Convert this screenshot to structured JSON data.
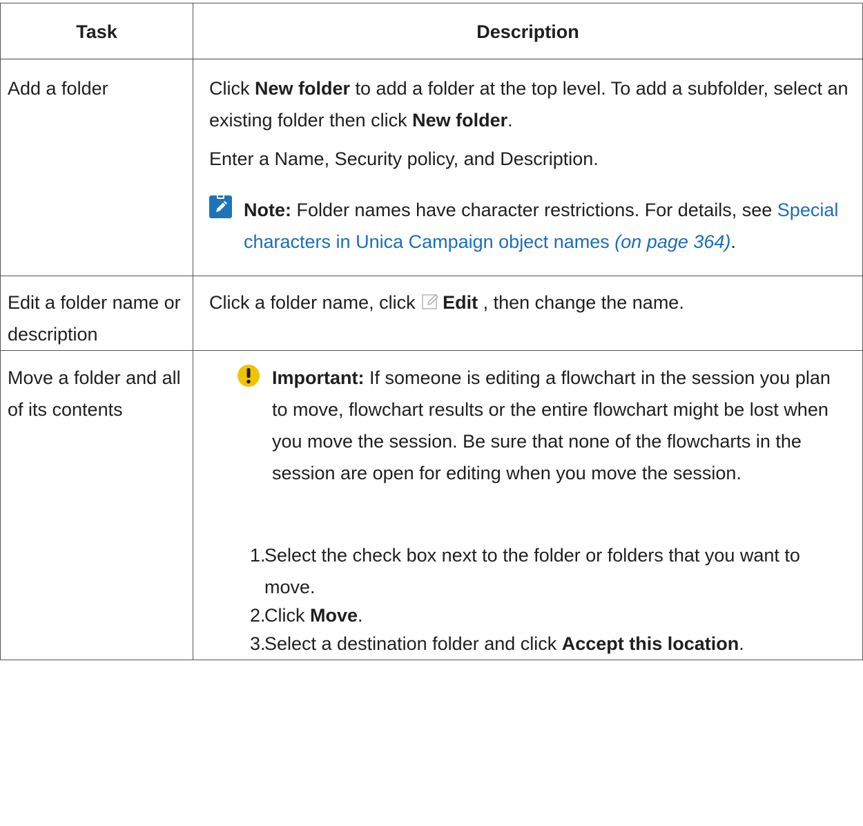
{
  "table": {
    "header": {
      "task": "Task",
      "description": "Description"
    },
    "rows": {
      "add": {
        "task": "Add a folder",
        "p1_a": "Click ",
        "p1_b": "New folder",
        "p1_c": " to add a folder at the top level. To add a subfolder, select an existing folder then click ",
        "p1_d": "New folder",
        "p1_e": ".",
        "p2": "Enter a Name, Security policy, and Description.",
        "note_label": "Note:",
        "note_text": " Folder names have character restrictions. For details, see ",
        "note_link": "Special characters in Unica Campaign object names",
        "note_link_page": "(on page 364)",
        "note_end": "."
      },
      "edit": {
        "task": "Edit a folder name or description",
        "a": "Click a folder name, click ",
        "b": "Edit",
        "c": " , then change the name."
      },
      "move": {
        "task": "Move a folder and all of its contents",
        "important_label": "Important:",
        "important_text": " If someone is editing a flowchart in the session you plan to move, flowchart results or the entire flowchart might be lost when you move the session. Be sure that none of the flowcharts in the session are open for editing when you move the session.",
        "steps": [
          {
            "num": "1.",
            "a": "Select the check box next to the folder or folders that you want to move.",
            "b": "",
            "c": ""
          },
          {
            "num": "2.",
            "a": "Click ",
            "b": "Move",
            "c": "."
          },
          {
            "num": "3.",
            "a": "Select a destination folder and click ",
            "b": "Accept this location",
            "c": "."
          }
        ]
      }
    }
  },
  "colors": {
    "link": "#1a6dbf",
    "note_icon": "#1f74b8",
    "important_icon": "#f0c400"
  }
}
